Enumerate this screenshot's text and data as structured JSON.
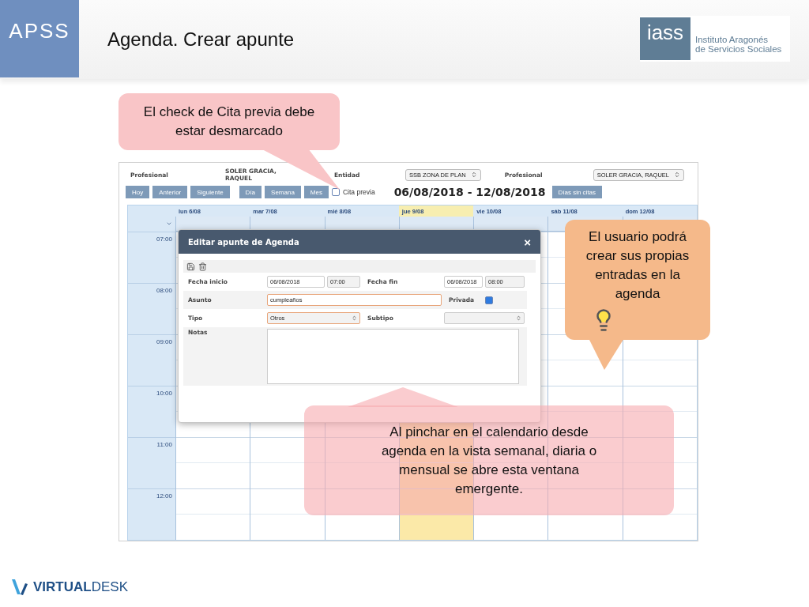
{
  "slide": {
    "badge": "APSS",
    "title": "Agenda. Crear apunte",
    "logo": {
      "mark": "iass",
      "line_1": "Instituto Aragonés",
      "line_2": "de Servicios Sociales"
    }
  },
  "filters": {
    "profesional_label": "Profesional",
    "profesional_value": "SOLER GRACIA, RAQUEL",
    "entidad_label": "Entidad",
    "entidad_select": "SSB ZONA DE PLAN",
    "profesional_label_2": "Profesional",
    "profesional_select": "SOLER GRACIA, RAQUEL"
  },
  "toolbar": {
    "buttons": [
      "Hoy",
      "Anterior",
      "Siguiente",
      "Día",
      "Semana",
      "Mes"
    ],
    "cita_previa": {
      "label": "Cita previa",
      "checked": false
    },
    "range": "06/08/2018 - 12/08/2018",
    "extra_button": "Días sin citas"
  },
  "calendar": {
    "days": [
      {
        "label": "lun 6/08",
        "selected": false
      },
      {
        "label": "mar 7/08",
        "selected": false
      },
      {
        "label": "mié 8/08",
        "selected": false
      },
      {
        "label": "jue 9/08",
        "selected": true
      },
      {
        "label": "vie 10/08",
        "selected": false
      },
      {
        "label": "sáb 11/08",
        "selected": false
      },
      {
        "label": "dom 12/08",
        "selected": false
      }
    ],
    "hours": [
      "07:00",
      "08:00",
      "09:00",
      "10:00",
      "11:00",
      "12:00"
    ]
  },
  "modal": {
    "title": "Editar apunte de Agenda",
    "close": "×",
    "fecha_inicio": {
      "label": "Fecha inicio",
      "date": "06/08/2018",
      "time": "07:00"
    },
    "fecha_fin": {
      "label": "Fecha fin",
      "date": "06/08/2018",
      "time": "08:00"
    },
    "asunto": {
      "label": "Asunto",
      "value": "cumpleaños"
    },
    "privada": {
      "label": "Privada",
      "checked": true
    },
    "tipo": {
      "label": "Tipo",
      "value": "Otros"
    },
    "subtipo": {
      "label": "Subtipo"
    },
    "notas": {
      "label": "Notas"
    }
  },
  "callouts": [
    {
      "kind": "note",
      "text": "El check de Cita previa debe estar desmarcado"
    },
    {
      "kind": "tip",
      "text": "El usuario podrá crear sus propias entradas en la agenda"
    },
    {
      "kind": "overlay",
      "text": "Al pinchar en el calendario desde agenda en la vista semanal, diaria o mensual se abre esta ventana emergente."
    }
  ],
  "footer": {
    "bold": "VIRTUAL",
    "light": "DESK"
  }
}
